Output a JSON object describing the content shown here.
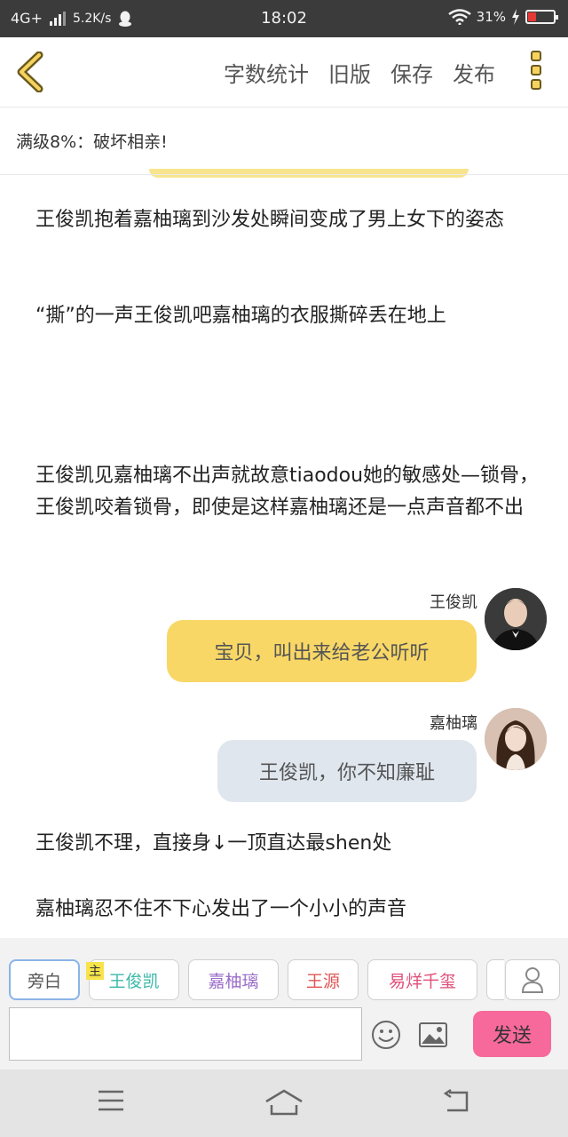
{
  "status_bar": {
    "network": "4G+",
    "speed": "5.2K/s",
    "time": "18:02",
    "battery": "31%",
    "battery_level": 0.31,
    "battery_color": "#e53935"
  },
  "toolbar": {
    "back_icon": "chevron-left-icon",
    "word_count": "字数统计",
    "old_version": "旧版",
    "save": "保存",
    "publish": "发布",
    "more_icon": "more-vertical-icon"
  },
  "subtitle": "满级8%：破坏相亲!",
  "story": {
    "para1": "王俊凯抱着嘉柚璃到沙发处瞬间变成了男上女下的姿态",
    "para2": "“撕”的一声王俊凯吧嘉柚璃的衣服撕碎丢在地上",
    "para3": "王俊凯见嘉柚璃不出声就故意tiaodou她的敏感处—锁骨，王俊凯咬着锁骨，即使是这样嘉柚璃还是一点声音都不出",
    "para4": "王俊凯不理，直接身↓一顶直达最shen处",
    "para5": "嘉柚璃忍不住不下心发出了一个小小的声音"
  },
  "messages": [
    {
      "speaker": "王俊凯",
      "text": "宝贝，叫出来给老公听听",
      "bubble_color": "#f8d766"
    },
    {
      "speaker": "嘉柚璃",
      "text": "王俊凯，你不知廉耻",
      "bubble_color": "#dfe6ee"
    }
  ],
  "composer": {
    "chips": [
      {
        "label": "旁白",
        "color": "#555555"
      },
      {
        "label": "王俊凯",
        "color": "#3bb8a8"
      },
      {
        "label": "嘉柚璃",
        "color": "#9b6cc9"
      },
      {
        "label": "王源",
        "color": "#e05555"
      },
      {
        "label": "易烊千玺",
        "color": "#e0507a"
      }
    ],
    "host_tag": "主",
    "input_value": "",
    "send_label": "发送",
    "accent": "#f7699a"
  },
  "nav": {
    "menu_icon": "menu-icon",
    "home_icon": "home-icon",
    "back_icon": "return-icon"
  }
}
